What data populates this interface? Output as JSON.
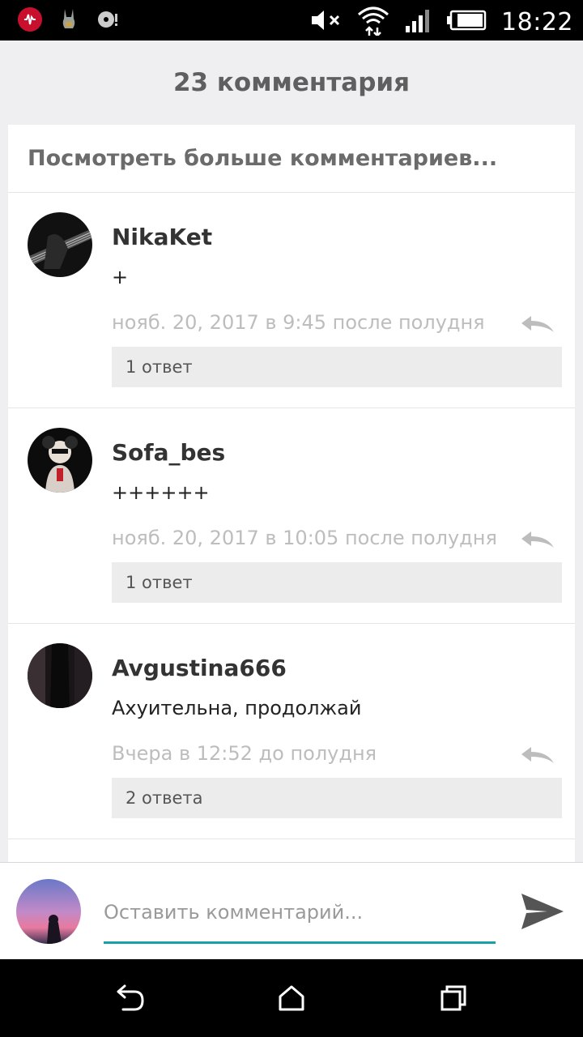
{
  "status_bar": {
    "time": "18:22",
    "left_icons": [
      "music-app-icon",
      "rabbit-app-icon",
      "disc-app-icon"
    ],
    "right_icons": [
      "mute-icon",
      "wifi-icon",
      "signal-icon",
      "battery-icon"
    ]
  },
  "header": {
    "title": "23 комментария"
  },
  "more_comments": {
    "label": "Посмотреть больше комментариев..."
  },
  "comments": [
    {
      "username": "NikaKet",
      "text": "+",
      "date": "нояб. 20, 2017 в 9:45 после полудня",
      "replies": "1 ответ"
    },
    {
      "username": "Sofa_bes",
      "text": "++++++",
      "date": "нояб. 20, 2017 в 10:05 после полудня",
      "replies": "1 ответ"
    },
    {
      "username": "Avgustina666",
      "text": "Ахуительна, продолжай",
      "date": "Вчера в 12:52 до полудня",
      "replies": "2 ответа"
    }
  ],
  "input": {
    "placeholder": "Оставить комментарий..."
  },
  "colors": {
    "accent": "#17a2a8",
    "background": "#efeff1",
    "reply_box": "#ececec"
  }
}
